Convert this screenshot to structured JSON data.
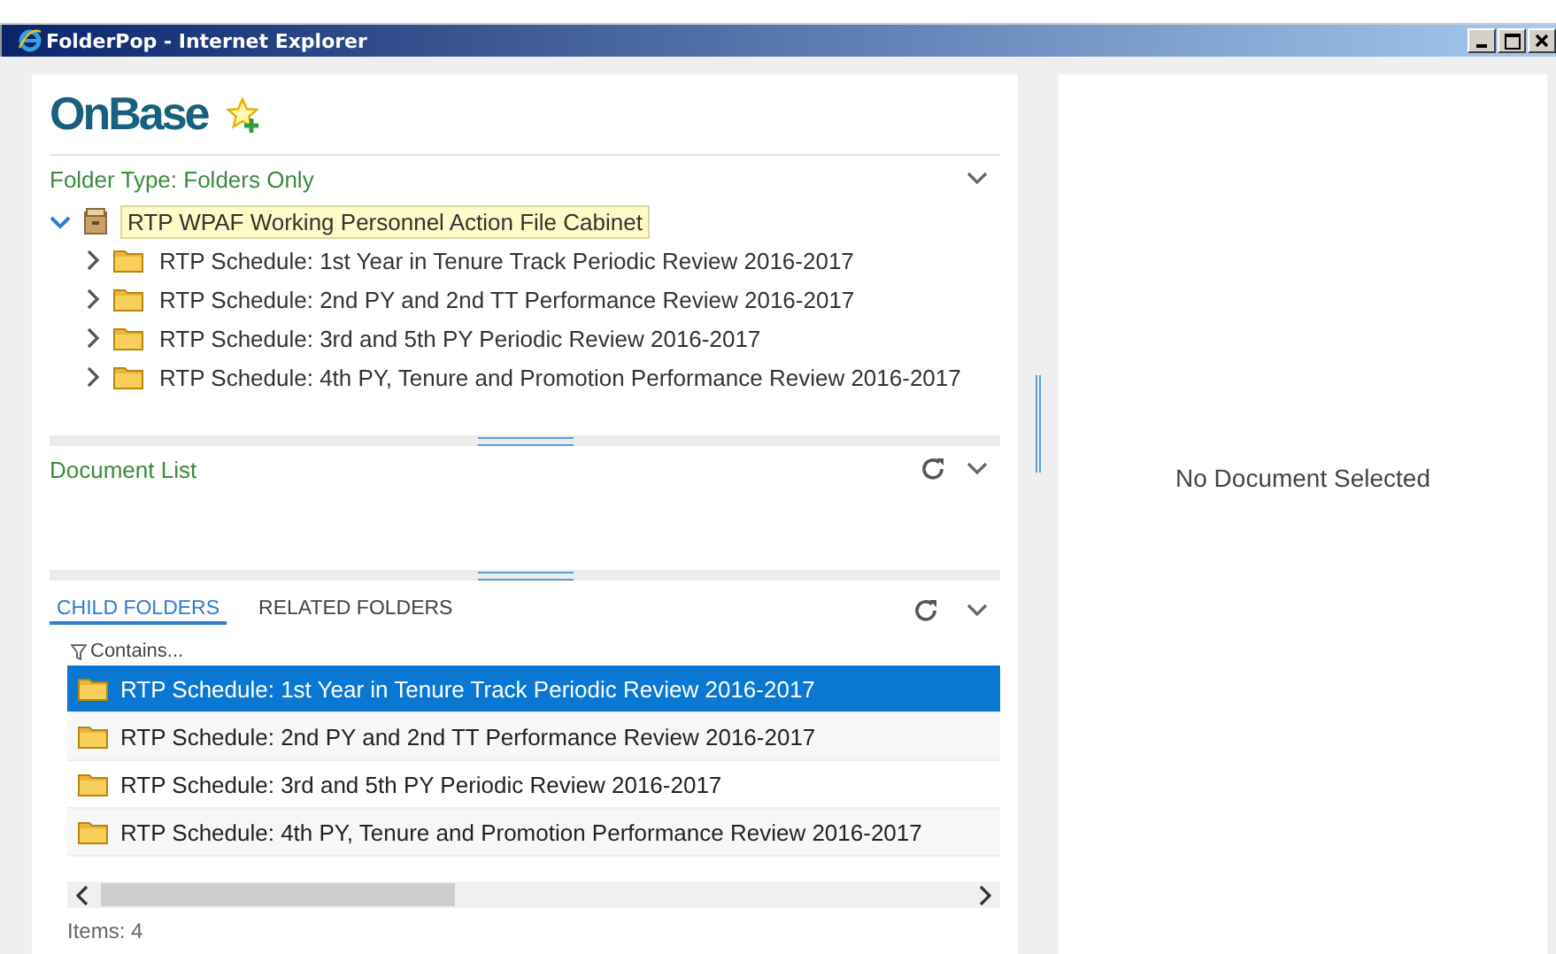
{
  "window": {
    "title": "FolderPop - Internet Explorer"
  },
  "logo": {
    "text": "OnBase"
  },
  "folder_type": {
    "title": "Folder Type: Folders Only",
    "expanded": true
  },
  "tree": [
    {
      "label": "RTP WPAF Working Personnel Action File Cabinet",
      "kind": "cabinet",
      "expanded": true,
      "selected": true,
      "children": [
        {
          "label": "RTP Schedule: 1st Year in Tenure Track Periodic Review 2016-2017",
          "expanded": false,
          "selected": false
        },
        {
          "label": "RTP Schedule: 2nd PY and 2nd TT Performance Review 2016-2017",
          "expanded": false,
          "selected": false
        },
        {
          "label": "RTP Schedule: 3rd and 5th PY Periodic Review 2016-2017",
          "expanded": false,
          "selected": false
        },
        {
          "label": "RTP Schedule: 4th PY, Tenure and Promotion Performance Review 2016-2017",
          "expanded": false,
          "selected": false
        }
      ]
    }
  ],
  "document_list": {
    "title": "Document List"
  },
  "tabs": [
    {
      "label": "CHILD FOLDERS",
      "selected": true
    },
    {
      "label": "RELATED FOLDERS",
      "selected": false
    }
  ],
  "filter": {
    "placeholder": "Contains..."
  },
  "rows": [
    {
      "label": "RTP Schedule: 1st Year in Tenure Track Periodic Review 2016-2017",
      "selected": true
    },
    {
      "label": "RTP Schedule: 2nd PY and 2nd TT Performance Review 2016-2017",
      "selected": false
    },
    {
      "label": "RTP Schedule: 3rd and 5th PY Periodic Review 2016-2017",
      "selected": false
    },
    {
      "label": "RTP Schedule: 4th PY, Tenure and Promotion Performance Review 2016-2017",
      "selected": false
    }
  ],
  "status": "Items: 4",
  "viewer": {
    "message": "No Document Selected"
  }
}
